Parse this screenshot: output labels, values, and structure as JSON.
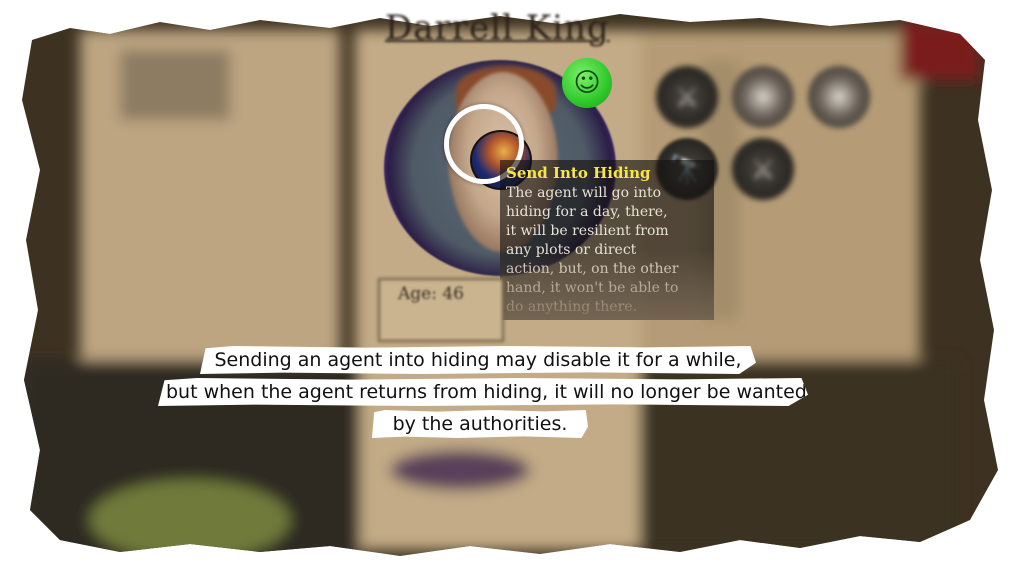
{
  "character": {
    "name": "Darrell King",
    "age_label": "Age: 46"
  },
  "mood_icon": "smiley-face-icon",
  "actions": [
    {
      "name": "sword-icon"
    },
    {
      "name": "blank-action-icon"
    },
    {
      "name": "blank-action-icon"
    },
    {
      "name": "spyglass-icon"
    },
    {
      "name": "sword-icon"
    }
  ],
  "tooltip": {
    "title": "Send Into Hiding",
    "description": "The agent will go into\nhiding for a day, there,\nit will be resilient from\nany plots or direct\naction, but, on the other\nhand, it won't be able to\ndo anything there."
  },
  "caption": {
    "line1": "Sending an agent into hiding may disable it for a while,",
    "line2": "but when the agent returns from hiding, it will no longer be wanted",
    "line3": "by the authorities."
  },
  "colors": {
    "parchment": "#b39a75",
    "tooltip_title": "#f6e64a",
    "mood_green": "#2fc92a",
    "frame_purple": "#4a2a8a"
  }
}
